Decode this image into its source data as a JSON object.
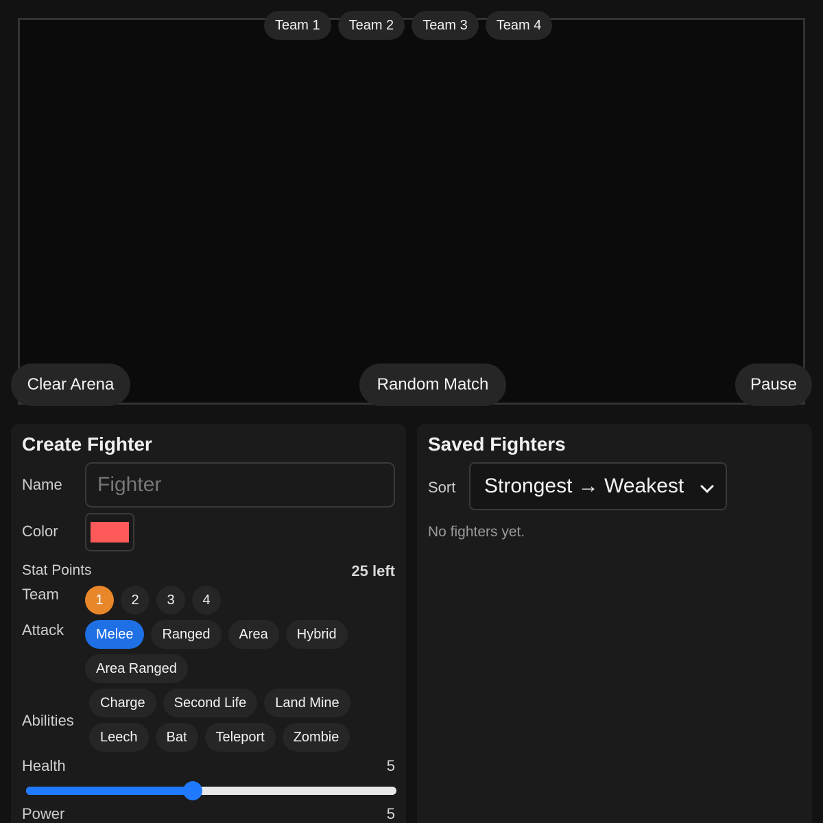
{
  "arena": {
    "teams": [
      {
        "label": "Team 1",
        "active": true
      },
      {
        "label": "Team 2",
        "active": false
      },
      {
        "label": "Team 3",
        "active": false
      },
      {
        "label": "Team 4",
        "active": false
      }
    ],
    "clear_label": "Clear Arena",
    "random_label": "Random Match",
    "pause_label": "Pause"
  },
  "create": {
    "title": "Create Fighter",
    "name_label": "Name",
    "name_placeholder": "Fighter",
    "name_value": "",
    "color_label": "Color",
    "color_value": "#ff5a5a",
    "stat_points_label": "Stat Points",
    "stat_points_left": "25 left",
    "team_label": "Team",
    "team_options": [
      "1",
      "2",
      "3",
      "4"
    ],
    "team_selected": "1",
    "attack_label": "Attack",
    "attack_options": [
      "Melee",
      "Ranged",
      "Area",
      "Hybrid",
      "Area Ranged"
    ],
    "attack_selected": "Melee",
    "abilities_label": "Abilities",
    "abilities": [
      "Charge",
      "Second Life",
      "Land Mine",
      "Leech",
      "Bat",
      "Teleport",
      "Zombie"
    ],
    "health_label": "Health",
    "health_value": "5",
    "health_fraction": 0.45,
    "power_label": "Power",
    "power_value": "5"
  },
  "saved": {
    "title": "Saved Fighters",
    "sort_label": "Sort",
    "sort_value": "Strongest → Weakest",
    "empty_text": "No fighters yet."
  },
  "colors": {
    "accent_orange": "#e8872a",
    "accent_blue": "#1f6fe5",
    "slider_blue": "#1f7aff"
  }
}
